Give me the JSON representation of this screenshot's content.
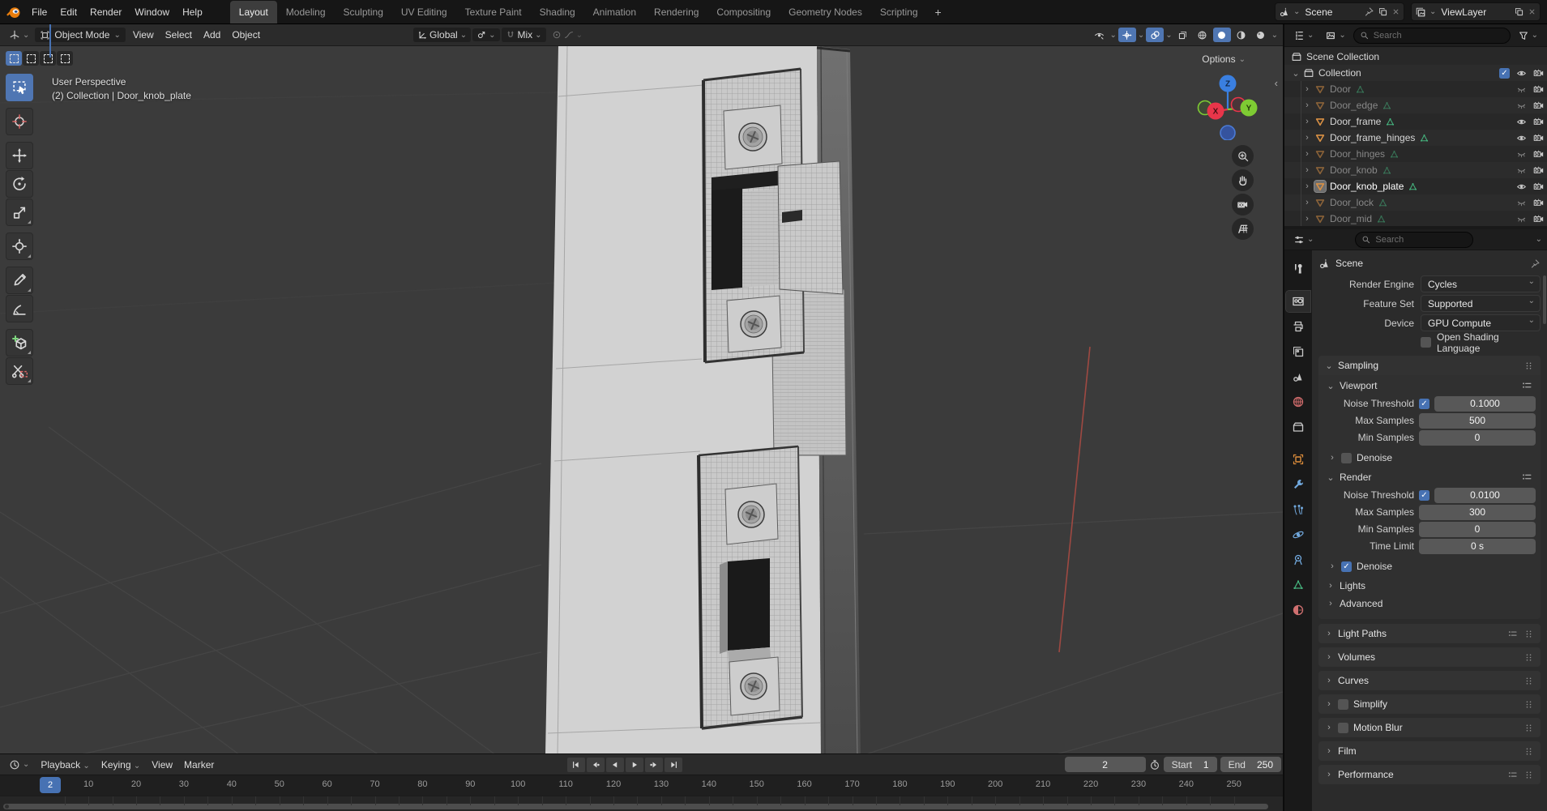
{
  "topbar": {
    "menus": [
      "File",
      "Edit",
      "Render",
      "Window",
      "Help"
    ],
    "workspaces": [
      "Layout",
      "Modeling",
      "Sculpting",
      "UV Editing",
      "Texture Paint",
      "Shading",
      "Animation",
      "Rendering",
      "Compositing",
      "Geometry Nodes",
      "Scripting"
    ],
    "active_workspace": "Layout",
    "new_workspace": "+",
    "scene_name": "Scene",
    "view_layer_name": "ViewLayer"
  },
  "viewport_header": {
    "mode": "Object Mode",
    "menus": [
      "View",
      "Select",
      "Add",
      "Object"
    ],
    "orientation": "Global",
    "snap_target": "Mix",
    "options": "Options"
  },
  "viewport": {
    "view_label": "User Perspective",
    "context_label": "(2) Collection | Door_knob_plate",
    "axis_x": "X",
    "axis_y": "Y",
    "axis_z": "Z"
  },
  "toolbar": {
    "tools": [
      "select-box",
      "cursor",
      "move",
      "rotate",
      "scale",
      "transform",
      "annotate",
      "measure",
      "add-cube",
      "duplicate"
    ],
    "active": "select-box"
  },
  "outliner": {
    "search_placeholder": "Search",
    "scene_collection": "Scene Collection",
    "collection": "Collection",
    "objects": [
      {
        "label": "Door",
        "visible": false,
        "active": false
      },
      {
        "label": "Door_edge",
        "visible": false,
        "active": false
      },
      {
        "label": "Door_frame",
        "visible": true,
        "active": false
      },
      {
        "label": "Door_frame_hinges",
        "visible": true,
        "active": false
      },
      {
        "label": "Door_hinges",
        "visible": false,
        "active": false
      },
      {
        "label": "Door_knob",
        "visible": false,
        "active": false
      },
      {
        "label": "Door_knob_plate",
        "visible": true,
        "active": true
      },
      {
        "label": "Door_lock",
        "visible": false,
        "active": false
      },
      {
        "label": "Door_mid",
        "visible": false,
        "active": false
      }
    ]
  },
  "properties": {
    "search_placeholder": "Search",
    "breadcrumb": "Scene",
    "tabs": [
      "tool",
      "render",
      "output",
      "view-layer",
      "scene",
      "world",
      "collection",
      "object",
      "modifiers",
      "particles",
      "physics",
      "constraints",
      "data",
      "material"
    ],
    "active_tab": "render",
    "render_engine_label": "Render Engine",
    "render_engine": "Cycles",
    "feature_set_label": "Feature Set",
    "feature_set": "Supported",
    "device_label": "Device",
    "device": "GPU Compute",
    "osl_label": "Open Shading Language",
    "sampling": {
      "title": "Sampling",
      "viewport": {
        "title": "Viewport",
        "noise_threshold_label": "Noise Threshold",
        "noise_threshold": "0.1000",
        "max_samples_label": "Max Samples",
        "max_samples": "500",
        "min_samples_label": "Min Samples",
        "min_samples": "0",
        "denoise_label": "Denoise"
      },
      "render": {
        "title": "Render",
        "noise_threshold_label": "Noise Threshold",
        "noise_threshold": "0.0100",
        "max_samples_label": "Max Samples",
        "max_samples": "300",
        "min_samples_label": "Min Samples",
        "min_samples": "0",
        "time_limit_label": "Time Limit",
        "time_limit": "0 s",
        "denoise_label": "Denoise"
      },
      "lights": "Lights",
      "advanced": "Advanced"
    },
    "bottom_panels": [
      {
        "label": "Light Paths",
        "preset": true,
        "checkbox": false
      },
      {
        "label": "Volumes",
        "preset": false,
        "checkbox": false
      },
      {
        "label": "Curves",
        "preset": false,
        "checkbox": false
      },
      {
        "label": "Simplify",
        "preset": false,
        "checkbox": true
      },
      {
        "label": "Motion Blur",
        "preset": false,
        "checkbox": true
      },
      {
        "label": "Film",
        "preset": false,
        "checkbox": false
      },
      {
        "label": "Performance",
        "preset": true,
        "checkbox": false
      }
    ]
  },
  "timeline": {
    "menus": [
      "Playback",
      "Keying",
      "View",
      "Marker"
    ],
    "current_frame": "2",
    "start_label": "Start",
    "start": "1",
    "end_label": "End",
    "end": "250",
    "tick_labels": [
      10,
      20,
      30,
      40,
      50,
      60,
      70,
      80,
      90,
      100,
      110,
      120,
      130,
      140,
      150,
      160,
      170,
      180,
      190,
      200,
      210,
      220,
      230,
      240,
      250
    ]
  },
  "colors": {
    "accent": "#4772b3",
    "object_orange": "#d99044",
    "mesh_green": "#45b27d",
    "axis_x": "#e8354a",
    "axis_y": "#7ecb33",
    "axis_z": "#3a7fe0"
  }
}
